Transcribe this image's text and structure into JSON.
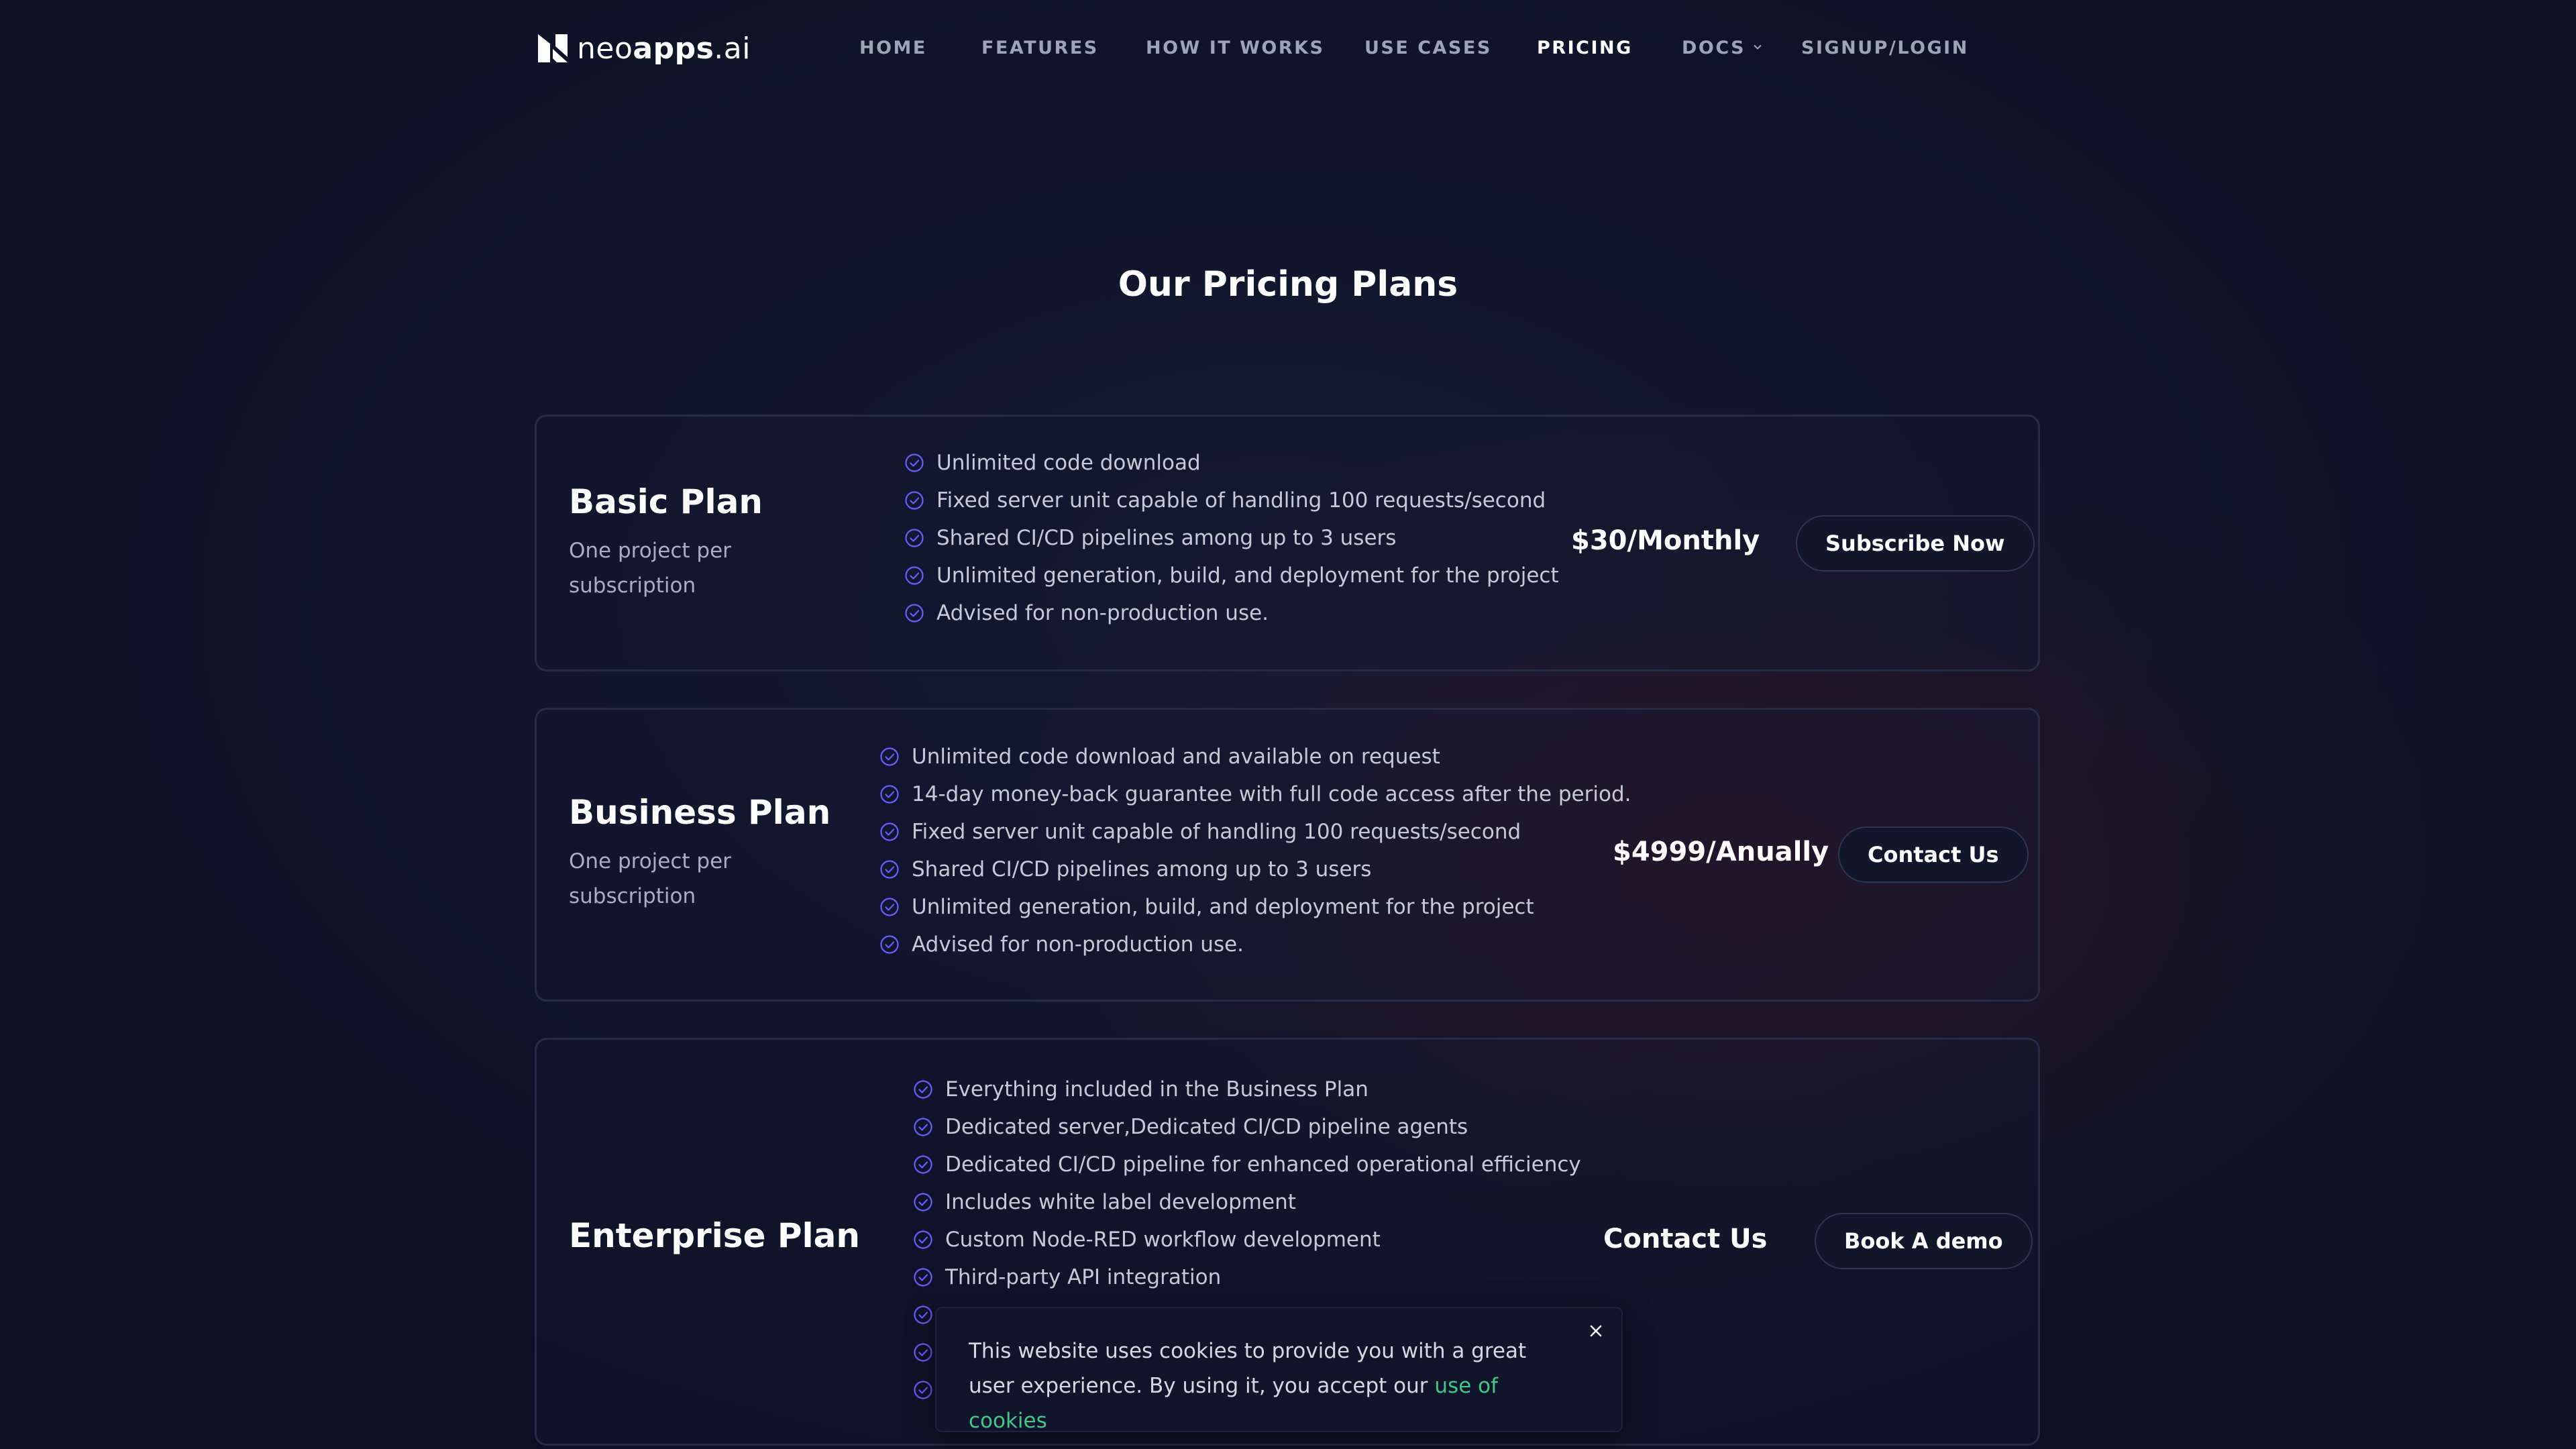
{
  "brand": {
    "name_light": "neo",
    "name_bold": "apps",
    "name_suffix": ".ai"
  },
  "nav": {
    "home": "HOME",
    "features": "FEATURES",
    "how_it_works": "HOW IT WORKS",
    "use_cases": "USE CASES",
    "pricing": "PRICING",
    "docs": "DOCS",
    "signup": "SIGNUP/LOGIN"
  },
  "page_title": "Our Pricing Plans",
  "plans": [
    {
      "name": "Basic Plan",
      "subtitle": "One project per subscription",
      "features": [
        "Unlimited code download",
        "Fixed server unit capable of handling 100 requests/second",
        "Shared CI/CD pipelines among up to 3 users",
        "Unlimited generation, build, and deployment for the project",
        "Advised for non-production use."
      ],
      "price": "$30/Monthly",
      "button": "Subscribe Now"
    },
    {
      "name": "Business Plan",
      "subtitle": "One project per subscription",
      "features": [
        "Unlimited code download and available on request",
        "14-day money-back guarantee with full code access after the period.",
        "Fixed server unit capable of handling 100 requests/second",
        "Shared CI/CD pipelines among up to 3 users",
        "Unlimited generation, build, and deployment for the project",
        "Advised for non-production use."
      ],
      "price": "$4999/Anually",
      "button": "Contact Us"
    },
    {
      "name": "Enterprise Plan",
      "features": [
        "Everything included in the Business Plan",
        "Dedicated server,Dedicated CI/CD pipeline agents",
        "Dedicated CI/CD pipeline for enhanced operational efficiency",
        "Includes white label development",
        "Custom Node-RED workflow development",
        "Third-party API integration"
      ],
      "price": "Contact Us",
      "button": "Book A demo"
    }
  ],
  "cookie": {
    "text": "This website uses cookies to provide you with a great user experience. By using it, you accept our ",
    "link": "use of cookies"
  },
  "colors": {
    "accent_check": "#6a5cff",
    "link_green": "#3fc88a",
    "background": "#0e1329"
  }
}
